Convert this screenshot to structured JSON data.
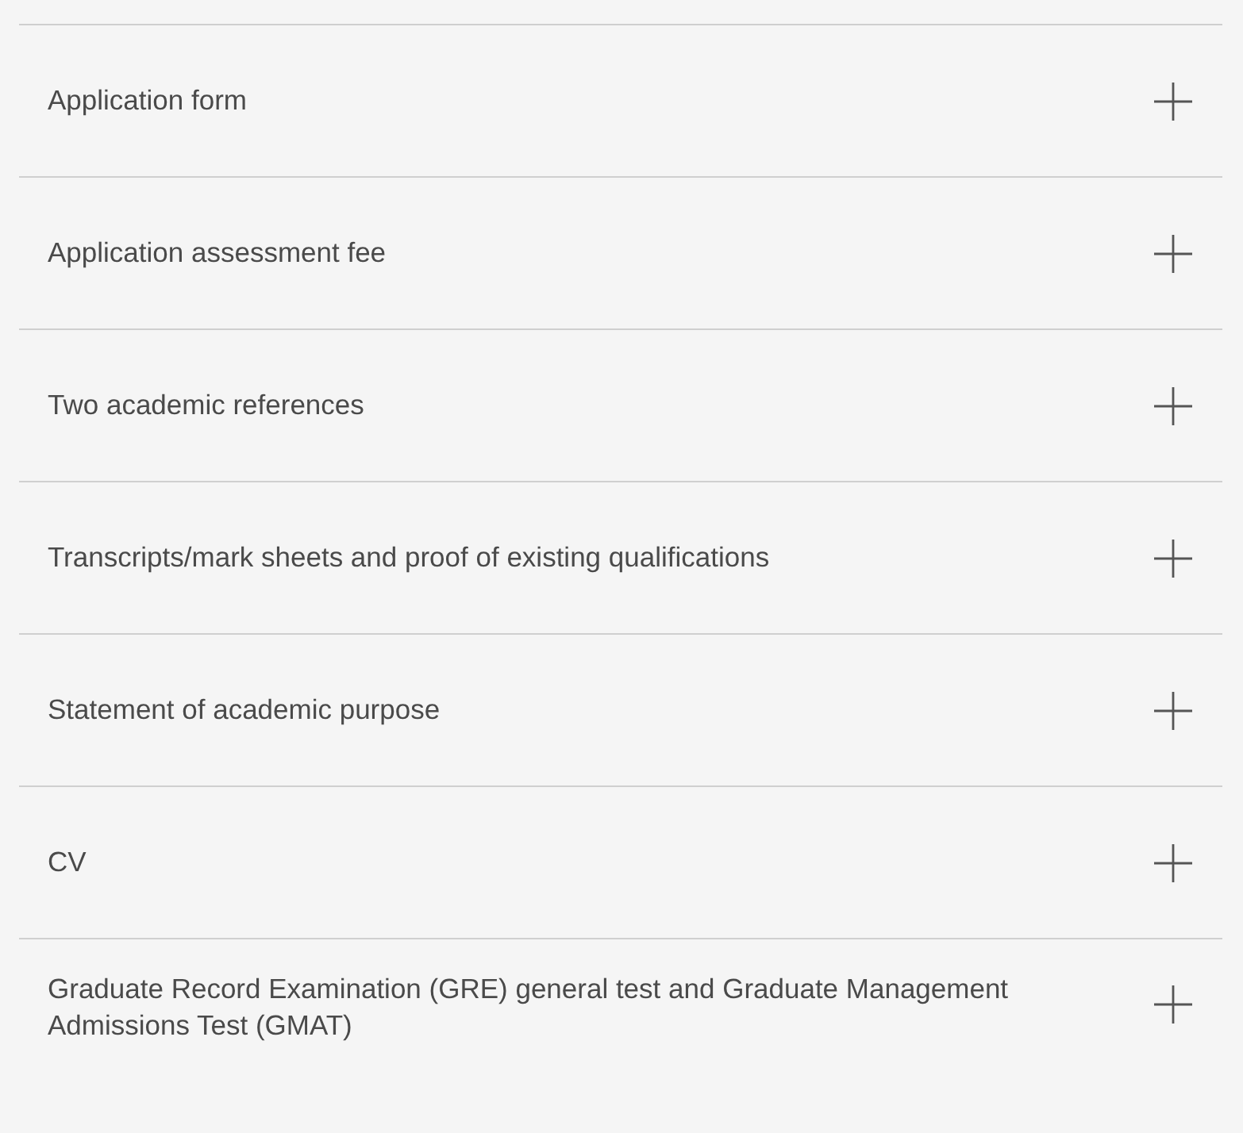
{
  "accordion": {
    "items": [
      {
        "title": "Application form",
        "expanded": false
      },
      {
        "title": "Application assessment fee",
        "expanded": false
      },
      {
        "title": "Two academic references",
        "expanded": false
      },
      {
        "title": "Transcripts/mark sheets and proof of existing qualifications",
        "expanded": false
      },
      {
        "title": "Statement of academic purpose",
        "expanded": false
      },
      {
        "title": "CV",
        "expanded": false
      },
      {
        "title": "Graduate Record Examination (GRE) general test and Graduate Management Admissions Test (GMAT)",
        "expanded": false
      }
    ]
  }
}
